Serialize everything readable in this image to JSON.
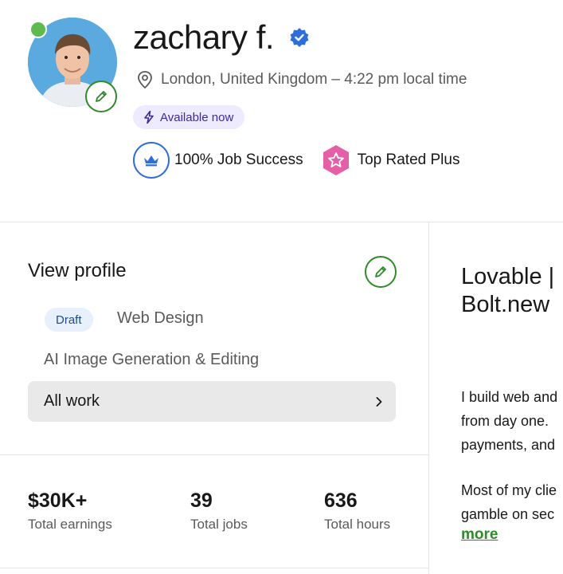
{
  "profile": {
    "name": "zachary f.",
    "location": "London, United Kingdom – 4:22 pm local time",
    "availability": "Available now",
    "job_success": "100% Job Success",
    "top_rated": "Top Rated Plus"
  },
  "specialized": {
    "title": "View profile",
    "draft_label": "Draft",
    "tabs": [
      "Web Design",
      "AI Image Generation & Editing"
    ],
    "all_work": "All work"
  },
  "stats": [
    {
      "value": "$30K+",
      "label": "Total earnings"
    },
    {
      "value": "39",
      "label": "Total jobs"
    },
    {
      "value": "636",
      "label": "Total hours"
    }
  ],
  "overview": {
    "headline_lines": [
      "Lovable |",
      "Bolt.new"
    ],
    "paragraph1": [
      "I build web and",
      "from day one.",
      "payments, and"
    ],
    "paragraph2": [
      "Most of my clie",
      "gamble on sec"
    ],
    "more": "more"
  },
  "colors": {
    "accent_green": "#2f8b2a",
    "verified_blue": "#2f6ed9",
    "online_green": "#5fbb4e",
    "top_rated_pink": "#e55fa8",
    "availability_purple": "#3e2a9c"
  },
  "icons": [
    "verified-icon",
    "location-pin-icon",
    "lightning-icon",
    "crown-icon",
    "top-rated-star-icon",
    "pencil-icon",
    "chevron-right-icon"
  ]
}
